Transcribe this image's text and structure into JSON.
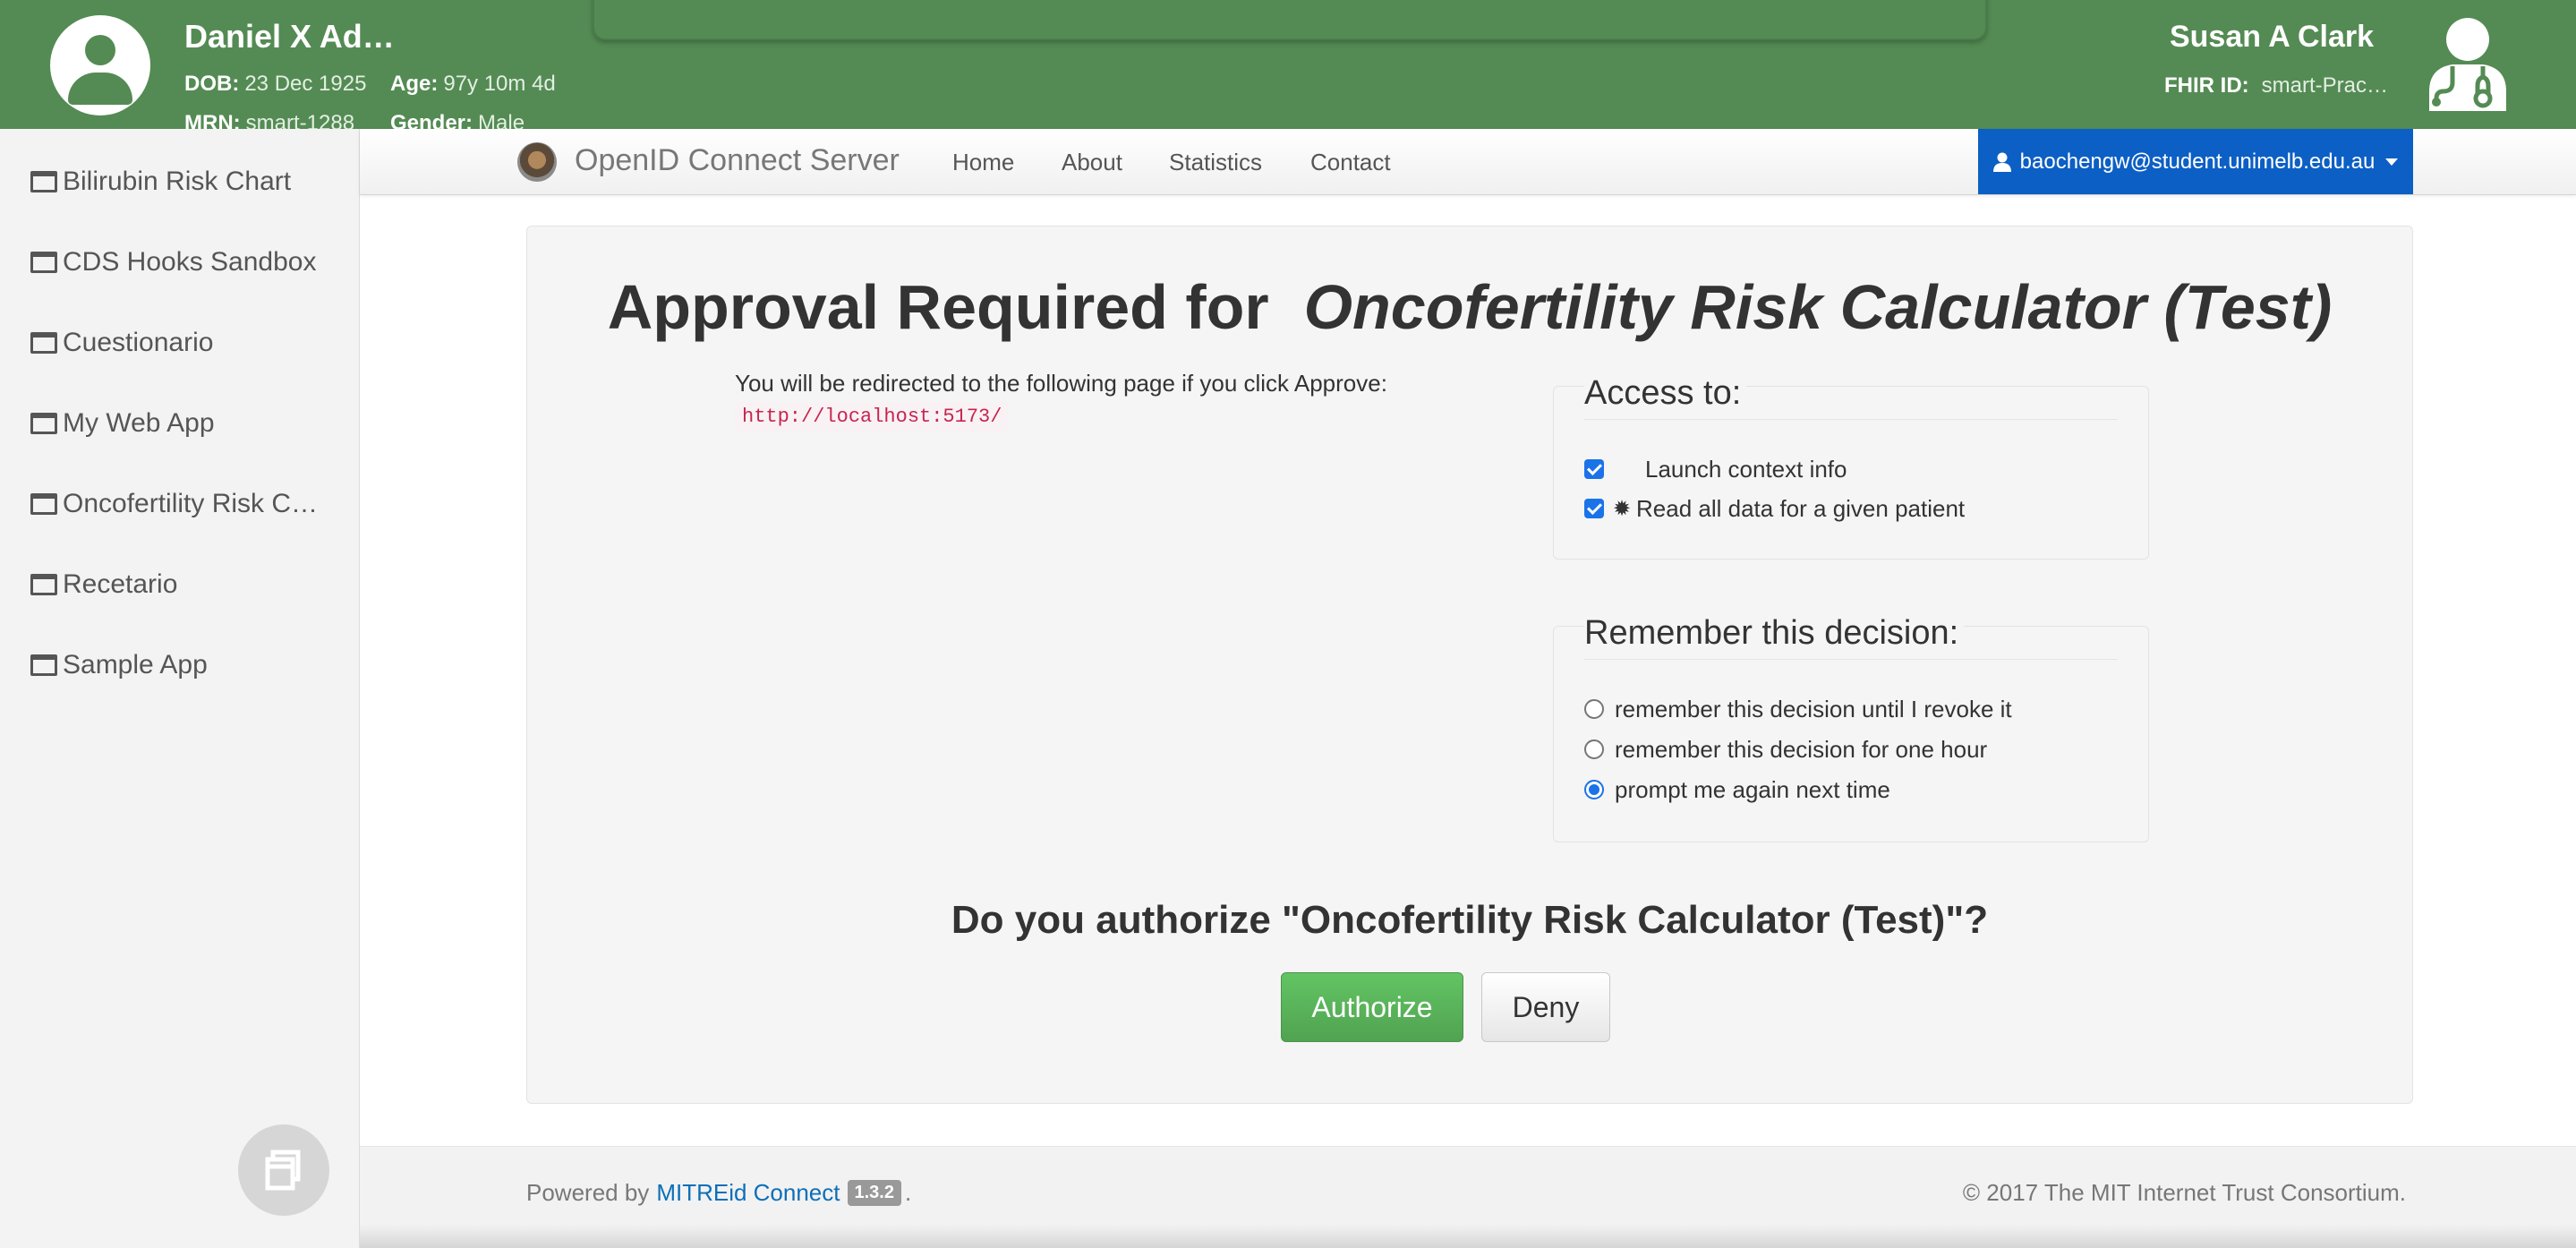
{
  "patient": {
    "name": "Daniel X Ad…",
    "dob_label": "DOB:",
    "dob_value": "23 Dec 1925",
    "age_label": "Age:",
    "age_value": "97y 10m 4d",
    "mrn_label": "MRN:",
    "mrn_value": "smart-1288",
    "gender_label": "Gender:",
    "gender_value": "Male"
  },
  "practitioner": {
    "name": "Susan A Clark",
    "fhir_label": "FHIR ID:",
    "fhir_value": "smart-Prac…"
  },
  "sidebar": {
    "items": [
      {
        "label": "Bilirubin Risk Chart"
      },
      {
        "label": "CDS Hooks Sandbox"
      },
      {
        "label": "Cuestionario"
      },
      {
        "label": "My Web App"
      },
      {
        "label": "Oncofertility Risk C…"
      },
      {
        "label": "Recetario"
      },
      {
        "label": "Sample App"
      }
    ]
  },
  "navbar": {
    "brand": "OpenID Connect Server",
    "links": [
      "Home",
      "About",
      "Statistics",
      "Contact"
    ],
    "user": "baochengw@student.unimelb.edu.au"
  },
  "approval": {
    "title_prefix": "Approval Required for",
    "client_name": "Oncofertility Risk Calculator (Test)",
    "redirect_text": "You will be redirected to the following page if you click Approve:",
    "redirect_url": "http://localhost:5173/",
    "access_legend": "Access to:",
    "scopes": [
      {
        "label": "Launch context info",
        "checked": true,
        "icon": ""
      },
      {
        "label": "Read all data for a given patient",
        "checked": true,
        "icon": "✹"
      }
    ],
    "remember_legend": "Remember this decision:",
    "remember_options": [
      {
        "label": "remember this decision until I revoke it",
        "selected": false
      },
      {
        "label": "remember this decision for one hour",
        "selected": false
      },
      {
        "label": "prompt me again next time",
        "selected": true
      }
    ],
    "question": "Do you authorize \"Oncofertility Risk Calculator (Test)\"?",
    "authorize_label": "Authorize",
    "deny_label": "Deny"
  },
  "footer": {
    "powered_by": "Powered by",
    "link": "MITREid Connect",
    "version": "1.3.2",
    "period": ".",
    "copyright": "© 2017 The MIT Internet Trust Consortium."
  },
  "colors": {
    "banner": "#548b54",
    "primary": "#0c5fc4",
    "success": "#51a351"
  }
}
